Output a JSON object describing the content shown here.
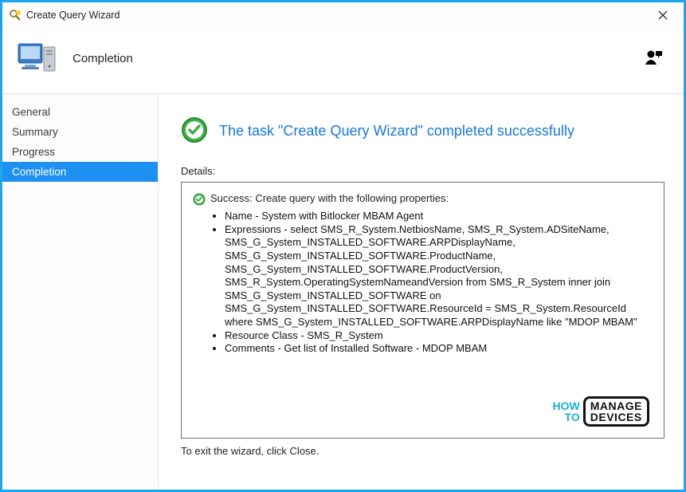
{
  "window": {
    "title": "Create Query Wizard"
  },
  "header": {
    "title": "Completion"
  },
  "sidebar": {
    "items": [
      {
        "label": "General",
        "active": false
      },
      {
        "label": "Summary",
        "active": false
      },
      {
        "label": "Progress",
        "active": false
      },
      {
        "label": "Completion",
        "active": true
      }
    ]
  },
  "main": {
    "status_title": "The task \"Create Query Wizard\" completed successfully",
    "details_label": "Details:",
    "success_line": "Success: Create query with the following properties:",
    "properties": {
      "name": {
        "label": "Name",
        "value": "System with Bitlocker MBAM Agent"
      },
      "expressions": {
        "label": "Expressions",
        "value": "select SMS_R_System.NetbiosName, SMS_R_System.ADSiteName, SMS_G_System_INSTALLED_SOFTWARE.ARPDisplayName, SMS_G_System_INSTALLED_SOFTWARE.ProductName, SMS_G_System_INSTALLED_SOFTWARE.ProductVersion, SMS_R_System.OperatingSystemNameandVersion from  SMS_R_System inner join SMS_G_System_INSTALLED_SOFTWARE on SMS_G_System_INSTALLED_SOFTWARE.ResourceId = SMS_R_System.ResourceId where SMS_G_System_INSTALLED_SOFTWARE.ARPDisplayName like \"MDOP MBAM\""
      },
      "resource_class": {
        "label": "Resource Class",
        "value": "SMS_R_System"
      },
      "comments": {
        "label": "Comments",
        "value": "Get list of Installed Software - MDOP MBAM"
      }
    },
    "exit_note": "To exit the wizard, click Close."
  },
  "watermark": {
    "left_line1": "HOW",
    "left_line2": "TO",
    "box_line1": "MANAGE",
    "box_line2": "DEVICES"
  }
}
